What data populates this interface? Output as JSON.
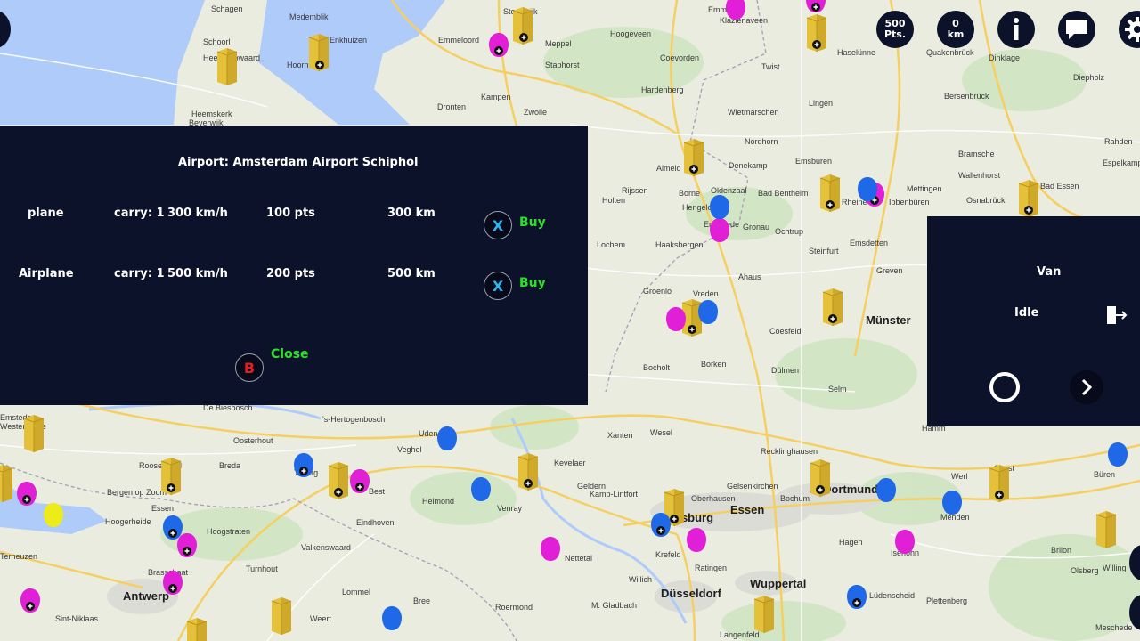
{
  "hud": {
    "points_value": "500",
    "points_unit": "Pts.",
    "distance_value": "0",
    "distance_unit": "km",
    "info_icon": "info-icon",
    "chat_icon": "chat-icon",
    "settings_icon": "gear-icon"
  },
  "airport_panel": {
    "title": "Airport: Amsterdam Airport Schiphol",
    "rows": [
      {
        "name": "plane",
        "carry": "carry: 1",
        "speed": "300 km/h",
        "points": "100 pts",
        "range": "300 km",
        "cancel_glyph": "X",
        "buy_label": "Buy"
      },
      {
        "name": "Airplane",
        "carry": "carry: 1",
        "speed": "500 km/h",
        "points": "200 pts",
        "range": "500 km",
        "cancel_glyph": "X",
        "buy_label": "Buy"
      }
    ],
    "close_glyph": "B",
    "close_label": "Close"
  },
  "vehicle_panel": {
    "vehicle": "Van",
    "status": "Idle",
    "exit_icon": "exit-icon",
    "circle_icon": "circle-icon",
    "next_icon": "chevron-right-icon"
  },
  "map": {
    "cities": [
      {
        "name": "Schagen"
      },
      {
        "name": "Medemblik"
      },
      {
        "name": "Enkhuizen"
      },
      {
        "name": "Hoorn"
      },
      {
        "name": "Schoorl"
      },
      {
        "name": "Heerhugowaard"
      },
      {
        "name": "Heemskerk"
      },
      {
        "name": "Beverwijk"
      },
      {
        "name": "Emmeloord"
      },
      {
        "name": "Steenwijk"
      },
      {
        "name": "Meppel"
      },
      {
        "name": "Staphorst"
      },
      {
        "name": "Kampen"
      },
      {
        "name": "Zwolle"
      },
      {
        "name": "Dronten"
      },
      {
        "name": "Hoogeveen"
      },
      {
        "name": "Coevorden"
      },
      {
        "name": "Emmen"
      },
      {
        "name": "Klazienaveen"
      },
      {
        "name": "Twist"
      },
      {
        "name": "Haselünne"
      },
      {
        "name": "Quakenbrück"
      },
      {
        "name": "Dinklage"
      },
      {
        "name": "Diepholz"
      },
      {
        "name": "Hardenberg"
      },
      {
        "name": "Wietmarschen"
      },
      {
        "name": "Lingen"
      },
      {
        "name": "Bersenbrück"
      },
      {
        "name": "Nordhorn"
      },
      {
        "name": "Almelo"
      },
      {
        "name": "Denekamp"
      },
      {
        "name": "Emsburen"
      },
      {
        "name": "Rijssen"
      },
      {
        "name": "Borne"
      },
      {
        "name": "Oldenzaal"
      },
      {
        "name": "Bad Bentheim"
      },
      {
        "name": "Holten"
      },
      {
        "name": "Hengelo"
      },
      {
        "name": "Enschede"
      },
      {
        "name": "Gronau"
      },
      {
        "name": "Ochtrup"
      },
      {
        "name": "Rheine"
      },
      {
        "name": "Ibbenbüren"
      },
      {
        "name": "Mettingen"
      },
      {
        "name": "Osnabrück"
      },
      {
        "name": "Bad Essen"
      },
      {
        "name": "Bramsche"
      },
      {
        "name": "Wallenhorst"
      },
      {
        "name": "Rahden"
      },
      {
        "name": "Espelkamp"
      },
      {
        "name": "Lochem"
      },
      {
        "name": "Haaksbergen"
      },
      {
        "name": "Steinfurt"
      },
      {
        "name": "Emsdetten"
      },
      {
        "name": "Greven"
      },
      {
        "name": "Groenlo"
      },
      {
        "name": "Vreden"
      },
      {
        "name": "Ahaus"
      },
      {
        "name": "Münster",
        "big": true
      },
      {
        "name": "Coesfeld"
      },
      {
        "name": "Bocholt"
      },
      {
        "name": "Borken"
      },
      {
        "name": "Dülmen"
      },
      {
        "name": "Selm"
      },
      {
        "name": "Hamm"
      },
      {
        "name": "Emstede"
      },
      {
        "name": "'s-Hertogenbosch"
      },
      {
        "name": "Oosterhout"
      },
      {
        "name": "Breda"
      },
      {
        "name": "Roosendaal"
      },
      {
        "name": "Bergen op Zoom"
      },
      {
        "name": "Essen"
      },
      {
        "name": "Hoogerheide"
      },
      {
        "name": "Terneuzen"
      },
      {
        "name": "Hoogstraten"
      },
      {
        "name": "Brasschaat"
      },
      {
        "name": "Antwerp",
        "big": true
      },
      {
        "name": "Sint-Niklaas"
      },
      {
        "name": "Turnhout"
      },
      {
        "name": "Tilburg"
      },
      {
        "name": "Best"
      },
      {
        "name": "Eindhoven"
      },
      {
        "name": "Valkenswaard"
      },
      {
        "name": "Lommel"
      },
      {
        "name": "Uden"
      },
      {
        "name": "Veghel"
      },
      {
        "name": "Helmond"
      },
      {
        "name": "Venray"
      },
      {
        "name": "Xanten"
      },
      {
        "name": "Wesel"
      },
      {
        "name": "Kevelaer"
      },
      {
        "name": "Geldern"
      },
      {
        "name": "Kamp-Lintfort"
      },
      {
        "name": "Oberhausen"
      },
      {
        "name": "Duisburg",
        "big": true
      },
      {
        "name": "Essen",
        "big": true
      },
      {
        "name": "Gelsenkirchen"
      },
      {
        "name": "Bochum"
      },
      {
        "name": "Recklinghausen"
      },
      {
        "name": "Dortmund",
        "big": true
      },
      {
        "name": "Werl"
      },
      {
        "name": "Soest"
      },
      {
        "name": "Menden"
      },
      {
        "name": "Hagen"
      },
      {
        "name": "Iserlohn"
      },
      {
        "name": "Krefeld"
      },
      {
        "name": "Ratingen"
      },
      {
        "name": "Wuppertal",
        "big": true
      },
      {
        "name": "Düsseldorf",
        "big": true
      },
      {
        "name": "Nettetal"
      },
      {
        "name": "Willich"
      },
      {
        "name": "Roermond"
      },
      {
        "name": "M. Gladbach"
      },
      {
        "name": "Weert"
      },
      {
        "name": "Bree"
      },
      {
        "name": "Langenfeld"
      },
      {
        "name": "Lüdenscheid"
      },
      {
        "name": "Plettenberg"
      },
      {
        "name": "Olsberg"
      },
      {
        "name": "Meschede"
      },
      {
        "name": "Brilon"
      },
      {
        "name": "Willing"
      },
      {
        "name": "Büren"
      },
      {
        "name": "De Biesbosch"
      },
      {
        "name": "Westerwolde"
      }
    ]
  }
}
